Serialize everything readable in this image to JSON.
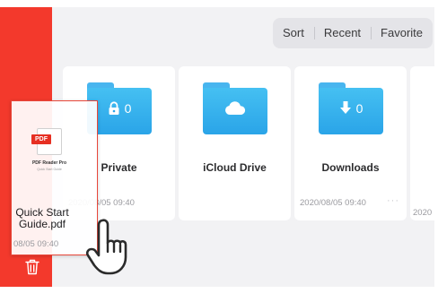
{
  "segmented_control": {
    "items": [
      "Sort",
      "Recent",
      "Favorite"
    ]
  },
  "folders": [
    {
      "name": "Private",
      "badge_count": "0",
      "date": "2020/08/05 09:40",
      "icon": "lock-icon"
    },
    {
      "name": "iCloud Drive",
      "badge_count": "",
      "date": "",
      "icon": "cloud-icon"
    },
    {
      "name": "Downloads",
      "badge_count": "0",
      "date": "2020/08/05 09:40",
      "icon": "download-arrow-icon"
    },
    {
      "name": "",
      "badge_count": "",
      "date": "2020",
      "icon": ""
    }
  ],
  "dragged_file": {
    "name": "Quick Start Guide.pdf",
    "date": "08/05 09:40",
    "thumb_badge": "PDF",
    "thumb_caption": "PDF Reader Pro",
    "thumb_subcaption": "Quick Start Guide"
  },
  "sidebar": {
    "icon": "trash-icon"
  },
  "colors": {
    "sidebar_red": "#f3392c",
    "folder_blue": "#2aa4e8",
    "drag_border": "#e8473a"
  }
}
